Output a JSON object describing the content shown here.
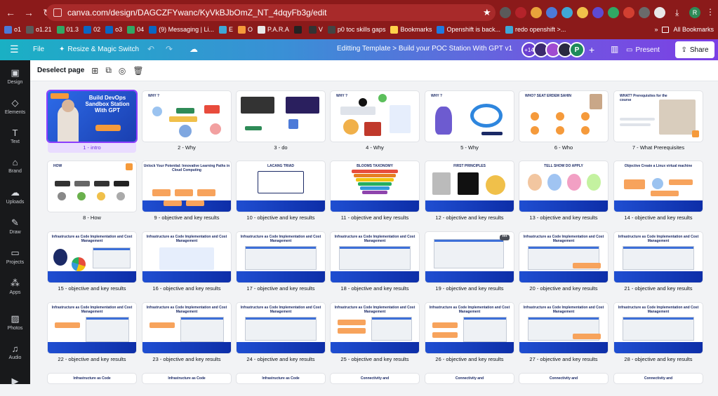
{
  "browser": {
    "url": "canva.com/design/DAGCZFYwanc/KyVkBJbOmZ_NT_4dqyFb3g/edit",
    "bookmarks": [
      "o1",
      "o1.21",
      "01.3",
      "02",
      "o3",
      "04",
      "(9) Messaging | Li...",
      "E",
      "O",
      "P.A.R.A",
      "",
      "V",
      "p0 toc skills gaps",
      "Bookmarks",
      "Openshift is back...",
      "redo openshift >..."
    ],
    "all_bookmarks": "All Bookmarks",
    "profile_initial": "R"
  },
  "appbar": {
    "file": "File",
    "resize": "Resize & Magic Switch",
    "title": "Editting Template > Build your  POC Station With GPT v12<...",
    "collab_count": "+14",
    "avatar_initial": "P",
    "present": "Present",
    "share": "Share"
  },
  "sidebar": [
    {
      "label": "Design",
      "icon": "design-icon",
      "glyph": "▣"
    },
    {
      "label": "Elements",
      "icon": "elements-icon",
      "glyph": "◇"
    },
    {
      "label": "Text",
      "icon": "text-icon",
      "glyph": "T"
    },
    {
      "label": "Brand",
      "icon": "brand-icon",
      "glyph": "⌂"
    },
    {
      "label": "Uploads",
      "icon": "uploads-icon",
      "glyph": "☁"
    },
    {
      "label": "Draw",
      "icon": "draw-icon",
      "glyph": "✎"
    },
    {
      "label": "Projects",
      "icon": "projects-icon",
      "glyph": "▭"
    },
    {
      "label": "Apps",
      "icon": "apps-icon",
      "glyph": "⁂"
    },
    {
      "label": "Photos",
      "icon": "photos-icon",
      "glyph": "▨"
    },
    {
      "label": "Audio",
      "icon": "audio-icon",
      "glyph": "♫"
    },
    {
      "label": "",
      "icon": "videos-icon",
      "glyph": "▶"
    }
  ],
  "toolbar": {
    "deselect": "Deselect page"
  },
  "slides": [
    {
      "label": "1 - intro",
      "kind": "cover",
      "title": "Build DevOps Sandbox Station With GPT"
    },
    {
      "label": "2 - Why",
      "kind": "why",
      "title": "WHY ?"
    },
    {
      "label": "3 - do",
      "kind": "do",
      "title": ""
    },
    {
      "label": "4 - Why",
      "kind": "why2",
      "title": "WHY ?"
    },
    {
      "label": "5 - Why",
      "kind": "why3",
      "title": "WHY ?"
    },
    {
      "label": "6 - Who",
      "kind": "who",
      "title": "WHO? SEAT ERDEM  SAHIN"
    },
    {
      "label": "7 - What Prerequisites",
      "kind": "what",
      "title": "WHAT? Prerequisites for the course"
    },
    {
      "label": "8 - How",
      "kind": "how",
      "title": "HOW"
    },
    {
      "label": "9 - objective and key results",
      "kind": "okr",
      "title": "Unlock Your Potential: Innovative Learning Paths in Cloud Computing"
    },
    {
      "label": "10 - objective and key results",
      "kind": "okr",
      "title": "LACANG TRIAD"
    },
    {
      "label": "11 - objective and key results",
      "kind": "okr",
      "title": "BLOOMS TAXONOMY"
    },
    {
      "label": "12 - objective and key results",
      "kind": "okr",
      "title": "FIRST PRINCIPLES"
    },
    {
      "label": "13 - objective and key results",
      "kind": "okr",
      "title": "TELL SHOW DO APPLY"
    },
    {
      "label": "14 - objective and key results",
      "kind": "okr",
      "title": "Objective Create a Linux virtual machine"
    },
    {
      "label": "15 - objective and key results",
      "kind": "iac",
      "title": "Infrastructure as Code Implementation and Cost Management"
    },
    {
      "label": "16 - objective and key results",
      "kind": "iac",
      "title": "Infrastructure as Code Implementation and Cost Management"
    },
    {
      "label": "17 - objective and key results",
      "kind": "iac",
      "title": "Infrastructure as Code Implementation and Cost Management"
    },
    {
      "label": "18 - objective and key results",
      "kind": "iac",
      "title": "Infrastructure as Code Implementation and Cost Management"
    },
    {
      "label": "19 - objective and key results",
      "kind": "iac",
      "title": ""
    },
    {
      "label": "20 - objective and key results",
      "kind": "iac",
      "title": "Infrastructure as Code Implementation and Cost Management"
    },
    {
      "label": "21 - objective and key results",
      "kind": "iac",
      "title": "Infrastructure as Code Implementation and Cost Management"
    },
    {
      "label": "22 - objective and key results",
      "kind": "iac",
      "title": "Infrastructure as Code Implementation and Cost Management"
    },
    {
      "label": "23 - objective and key results",
      "kind": "iac",
      "title": "Infrastructure as Code Implementation and Cost Management"
    },
    {
      "label": "24 - objective and key results",
      "kind": "iac",
      "title": "Infrastructure as Code Implementation and Cost Management"
    },
    {
      "label": "25 - objective and key results",
      "kind": "iac",
      "title": "Infrastructure as Code Implementation and Cost Management"
    },
    {
      "label": "26 - objective and key results",
      "kind": "iac",
      "title": "Infrastructure as Code Implementation and Cost Management"
    },
    {
      "label": "27 - objective and key results",
      "kind": "iac",
      "title": "Infrastructure as Code Implementation and Cost Management"
    },
    {
      "label": "28 - objective and key results",
      "kind": "iac",
      "title": "Infrastructure as Code Implementation and Cost Management"
    },
    {
      "label": "",
      "kind": "partial",
      "title": "Infrastructure as Code"
    },
    {
      "label": "",
      "kind": "partial",
      "title": "Infrastructure as Code"
    },
    {
      "label": "",
      "kind": "partial",
      "title": "Infrastructure as Code"
    },
    {
      "label": "",
      "kind": "partial",
      "title": "Connectivity and"
    },
    {
      "label": "",
      "kind": "partial",
      "title": "Connectivity and"
    },
    {
      "label": "",
      "kind": "partial",
      "title": "Connectivity and"
    },
    {
      "label": "",
      "kind": "partial",
      "title": "Connectivity and"
    }
  ],
  "selected_slide": 1,
  "colors": {
    "accent": "#8b3dff",
    "browser": "#8b1a1a",
    "slide_band": "#1f4ed1",
    "orange": "#f59a3b"
  }
}
